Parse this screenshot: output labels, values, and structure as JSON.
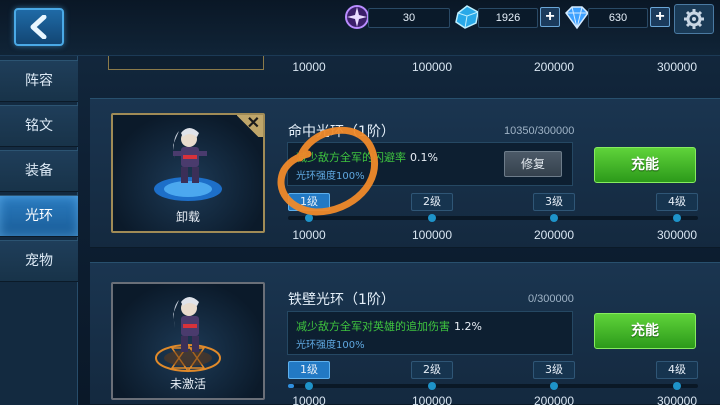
{
  "currencies": [
    {
      "name": "purple-crystal",
      "value": "30",
      "color": "#b98cff"
    },
    {
      "name": "blue-gem",
      "value": "1926",
      "color": "#2fb6ef"
    },
    {
      "name": "diamond",
      "value": "630",
      "color": "#3ea1ff"
    }
  ],
  "plus_label": "+",
  "sidebar": {
    "items": [
      {
        "label": "阵容",
        "active": false
      },
      {
        "label": "铭文",
        "active": false
      },
      {
        "label": "装备",
        "active": false
      },
      {
        "label": "光环",
        "active": true
      },
      {
        "label": "宠物",
        "active": false
      }
    ]
  },
  "prev_row_levels": [
    "10000",
    "100000",
    "200000",
    "300000"
  ],
  "auras": [
    {
      "title": "命中光环（1阶）",
      "progress": "10350/300000",
      "desc_green": "减少敌方全军的闪避率",
      "desc_value": "0.1%",
      "strength": "光环强度100%",
      "repair_label": "修复",
      "charge_label": "充能",
      "card_caption": "卸载",
      "level_tabs": [
        "1级",
        "2级",
        "3级",
        "4级"
      ],
      "active_level": 0,
      "levels": [
        "10000",
        "100000",
        "200000",
        "300000"
      ],
      "fill_fraction": 0.0
    },
    {
      "title": "铁壁光环（1阶）",
      "progress": "0/300000",
      "desc_green": "减少敌方全军对英雄的追加伤害",
      "desc_value": "1.2%",
      "strength": "光环强度100%",
      "charge_label": "充能",
      "card_caption": "未激活",
      "level_tabs": [
        "1级",
        "2级",
        "3级",
        "4级"
      ],
      "active_level": 0,
      "levels": [
        "10000",
        "100000",
        "200000",
        "300000"
      ],
      "fill_fraction": 0.0
    }
  ],
  "colors": {
    "accent": "#2279c4",
    "green_button": "#3fb526",
    "annotation": "#f08a2a"
  }
}
